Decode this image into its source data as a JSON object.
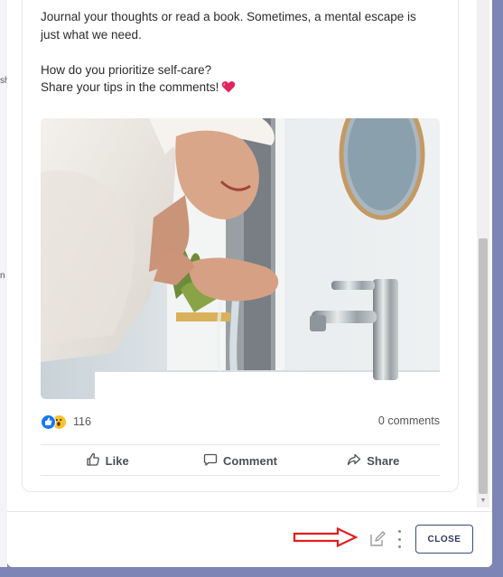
{
  "background": {
    "edge_chars": [
      "sh",
      "n"
    ]
  },
  "post": {
    "text_line1": "Journal your thoughts or read a book. Sometimes, a mental escape is",
    "text_line2": "just what we need.",
    "text_line3": "How do you prioritize self-care?",
    "text_line4": "Share your tips in the comments!",
    "emoji": "heart-icon",
    "image_alt": "woman-washing-face-photo",
    "reaction_count": "116",
    "comments_count": "0 comments",
    "reactions": [
      "like-reaction-icon",
      "wow-reaction-icon"
    ]
  },
  "actions": {
    "like_label": "Like",
    "comment_label": "Comment",
    "share_label": "Share"
  },
  "footer": {
    "close_label": "CLOSE"
  },
  "colors": {
    "overlay": "#7d84b6",
    "like_blue": "#1877f2",
    "close_border": "#3b4b7a",
    "annotation_red": "#e11d1d",
    "heart": "#e0245e"
  }
}
